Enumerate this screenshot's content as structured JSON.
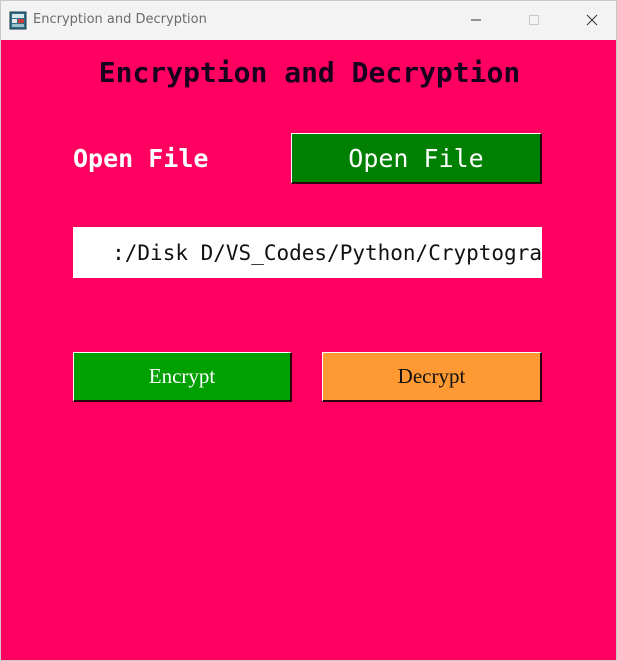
{
  "window": {
    "title": "Encryption and Decryption",
    "controls": {
      "minimize": "minimize",
      "maximize": "maximize",
      "close": "close"
    }
  },
  "app": {
    "heading": "Encryption and Decryption",
    "open_file_label": "Open File",
    "open_file_button": "Open File",
    "file_path_value": ":/Disk D/VS_Codes/Python/Cryptogra",
    "encrypt_button": "Encrypt",
    "decrypt_button": "Decrypt"
  },
  "colors": {
    "background": "#ff0060",
    "open_button": "#008000",
    "encrypt_button": "#00a000",
    "decrypt_button": "#ff9933",
    "heading_text": "#1a001f"
  },
  "icons": {
    "app": "app-window-icon",
    "minimize": "minimize-icon",
    "maximize": "maximize-icon",
    "close": "close-icon"
  }
}
